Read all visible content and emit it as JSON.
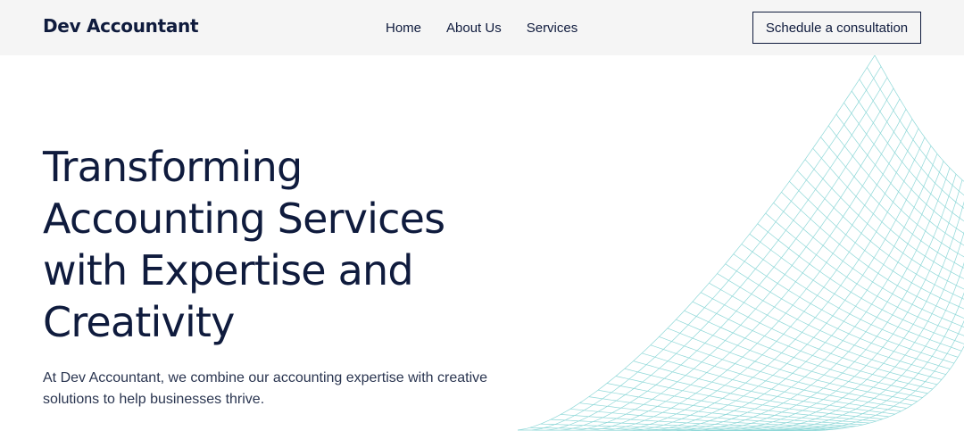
{
  "header": {
    "brand": "Dev Accountant",
    "nav": [
      {
        "label": "Home"
      },
      {
        "label": "About Us"
      },
      {
        "label": "Services"
      }
    ],
    "cta_label": "Schedule a consultation"
  },
  "hero": {
    "headline_lines": [
      "Transforming",
      "Accounting Services",
      "with Expertise and",
      "Creativity"
    ],
    "subtext": "At Dev Accountant, we combine our accounting expertise with creative solutions to help businesses thrive."
  },
  "colors": {
    "navy": "#0f1b3d",
    "header_bg": "#f5f5f5",
    "grid_line": "#8fd8d8"
  }
}
